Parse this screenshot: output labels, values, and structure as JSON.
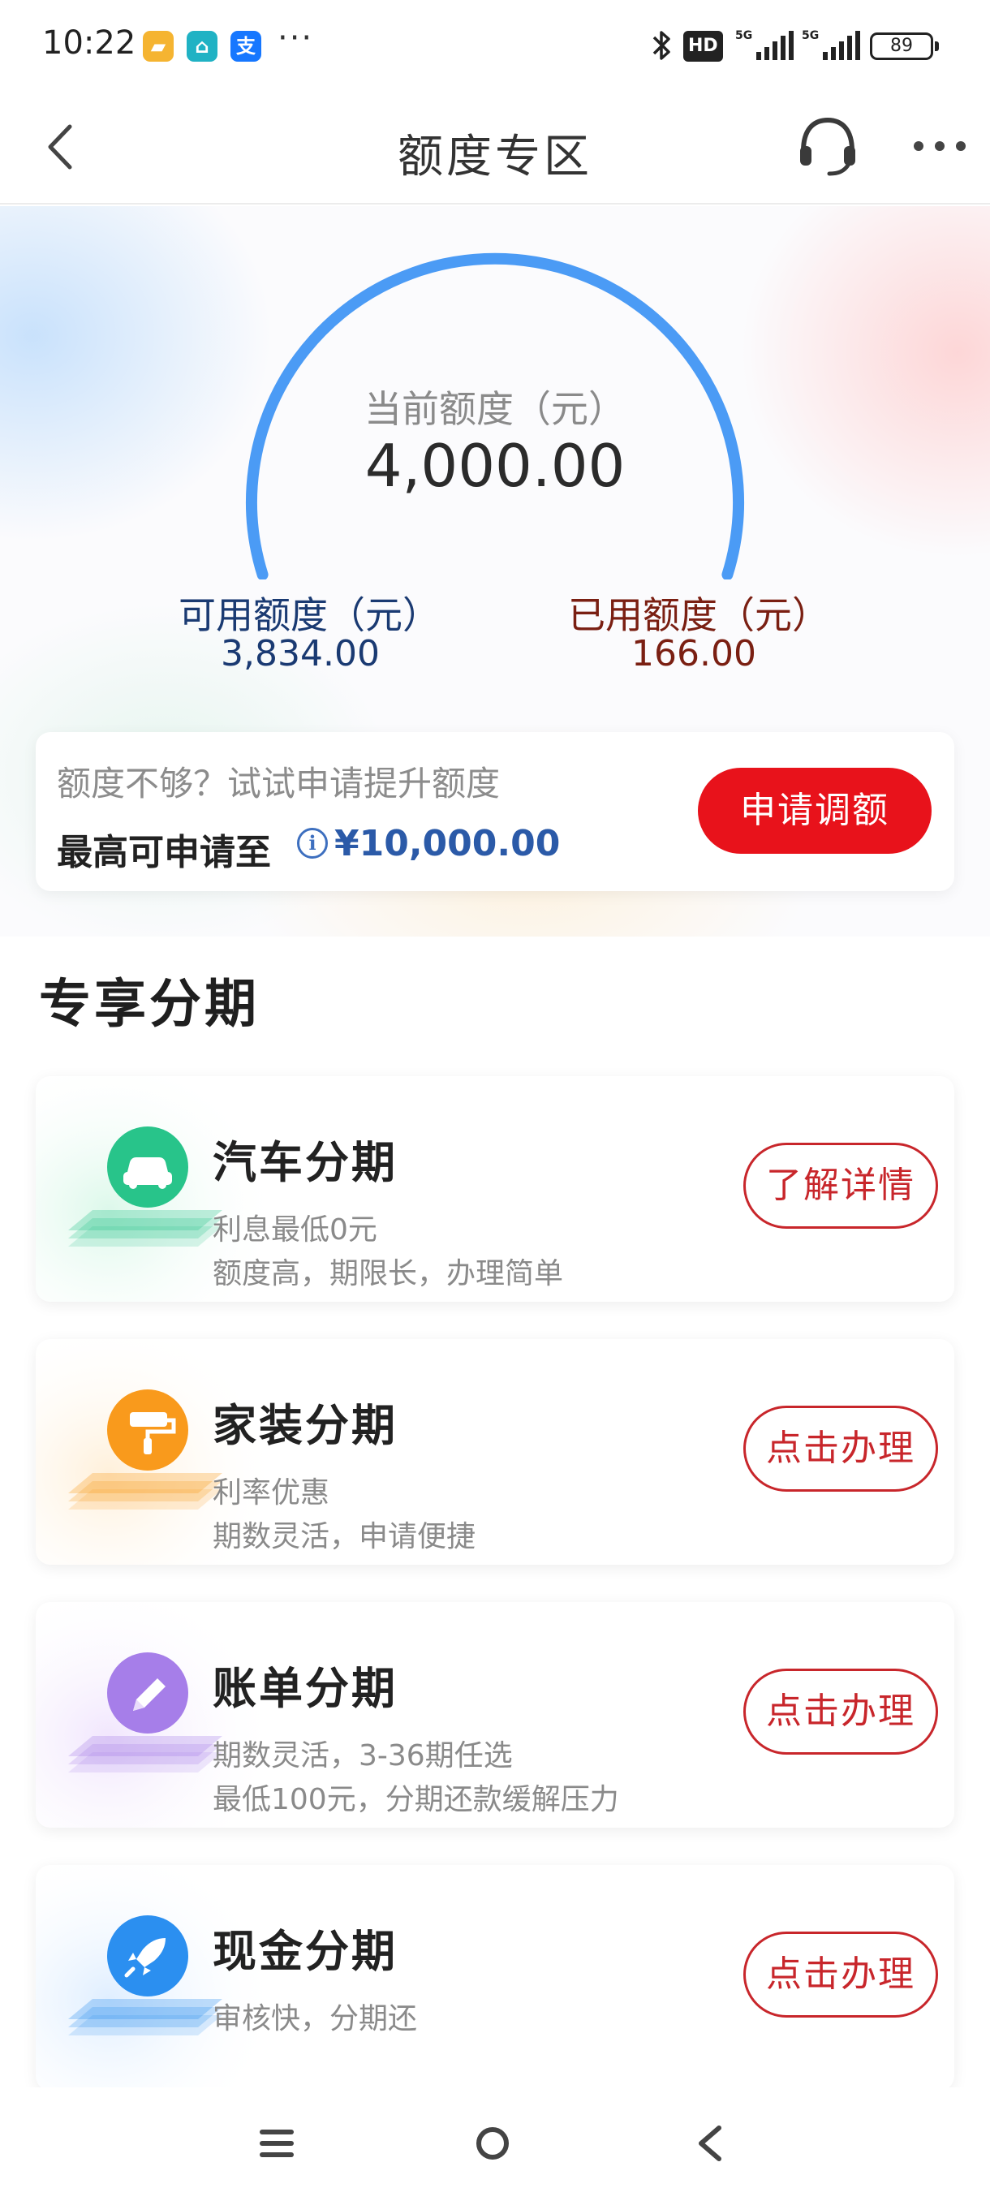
{
  "status_bar": {
    "time": "10:22",
    "app_icons": [
      {
        "name": "notes-app-icon",
        "color": "#f5b431",
        "glyph": "▰"
      },
      {
        "name": "home-app-icon",
        "color": "#20b2c4",
        "glyph": "⌂"
      },
      {
        "name": "alipay-app-icon",
        "color": "#1677ff",
        "glyph": "支"
      }
    ],
    "more": "···",
    "hd_badge": "HD",
    "network": [
      "5G",
      "5G"
    ],
    "battery": "89"
  },
  "header": {
    "title": "额度专区"
  },
  "limit": {
    "label": "当前额度（元）",
    "value": "4,000.00",
    "available_label": "可用额度（元）",
    "available_value": "3,834.00",
    "used_label": "已用额度（元）",
    "used_value": "166.00",
    "used_fraction": 0.0415
  },
  "raise": {
    "hint": "额度不够？试试申请提升额度",
    "max_label": "最高可申请至",
    "info_glyph": "i",
    "max_value": "¥10,000.00",
    "button": "申请调额"
  },
  "section": {
    "title": "专享分期"
  },
  "products": [
    {
      "title": "汽车分期",
      "desc1": "利息最低0元",
      "desc2": "额度高，期限长，办理简单",
      "button": "了解详情",
      "icon": "car-icon",
      "color": "#28c48a",
      "tint": "#dcf8ea"
    },
    {
      "title": "家装分期",
      "desc1": "利率优惠",
      "desc2": "期数灵活，申请便捷",
      "button": "点击办理",
      "icon": "paint-roller-icon",
      "color": "#f99a1c",
      "tint": "#fff0da"
    },
    {
      "title": "账单分期",
      "desc1": "期数灵活，3-36期任选",
      "desc2": "最低100元，分期还款缓解压力",
      "button": "点击办理",
      "icon": "pencil-icon",
      "color": "#a67ee9",
      "tint": "#f1e6fd"
    },
    {
      "title": "现金分期",
      "desc1": "审核快，分期还",
      "desc2": "",
      "button": "点击办理",
      "icon": "rocket-icon",
      "color": "#2b8ff0",
      "tint": "#dfeeff"
    }
  ],
  "colors": {
    "accent_red": "#e8121b",
    "gauge_blue": "#4b9bf5",
    "gauge_orange": "#ff5a1f",
    "available_text": "#1a3a72",
    "used_text": "#7a1f12"
  }
}
